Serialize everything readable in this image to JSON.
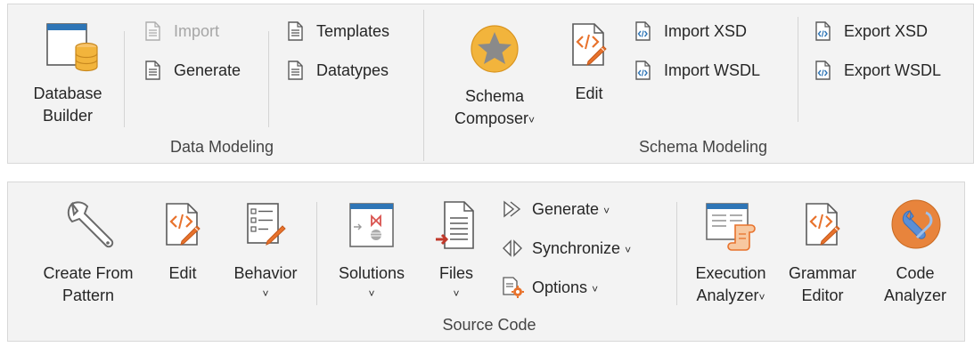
{
  "data_modeling": {
    "group_label": "Data Modeling",
    "database_builder": {
      "line1": "Database",
      "line2": "Builder"
    },
    "import_label": "Import",
    "generate_label": "Generate",
    "templates_label": "Templates",
    "datatypes_label": "Datatypes"
  },
  "schema_modeling": {
    "group_label": "Schema Modeling",
    "schema_composer": {
      "line1": "Schema",
      "line2": "Composer"
    },
    "edit_label": "Edit",
    "import_xsd_label": "Import XSD",
    "import_wsdl_label": "Import WSDL",
    "export_xsd_label": "Export XSD",
    "export_wsdl_label": "Export WSDL"
  },
  "source_code": {
    "group_label": "Source Code",
    "create_from_pattern": {
      "line1": "Create From",
      "line2": "Pattern"
    },
    "edit_label": "Edit",
    "behavior_label": "Behavior",
    "solutions_label": "Solutions",
    "files_label": "Files",
    "generate_label": "Generate",
    "synchronize_label": "Synchronize",
    "options_label": "Options",
    "execution_analyzer": {
      "line1": "Execution",
      "line2": "Analyzer"
    },
    "grammar_editor": {
      "line1": "Grammar",
      "line2": "Editor"
    },
    "code_analyzer": {
      "line1": "Code",
      "line2": "Analyzer"
    }
  },
  "icons": {
    "database_builder": "database-icon",
    "import": "document-icon",
    "generate": "document-icon",
    "templates": "document-icon",
    "datatypes": "document-icon",
    "schema_composer": "star-icon",
    "edit": "code-edit-icon",
    "import_xsd": "xml-document-icon",
    "import_wsdl": "xml-document-icon",
    "export_xsd": "xml-document-icon",
    "export_wsdl": "xml-document-icon",
    "create_from_pattern": "wrench-icon",
    "behavior": "list-edit-icon",
    "solutions": "solution-icon",
    "files": "files-icon",
    "generate_sc": "generate-arrow-icon",
    "synchronize": "synchronize-icon",
    "options": "options-gear-icon",
    "execution_analyzer": "execution-analyzer-icon",
    "grammar_editor": "code-edit-icon",
    "code_analyzer": "code-analyzer-icon"
  },
  "colors": {
    "ribbon_bg": "#f3f3f3",
    "text": "#262626",
    "disabled_text": "#a6a6a6",
    "accent_orange": "#e8722c",
    "accent_blue": "#2e75b6",
    "star_gold": "#f2b43c"
  }
}
